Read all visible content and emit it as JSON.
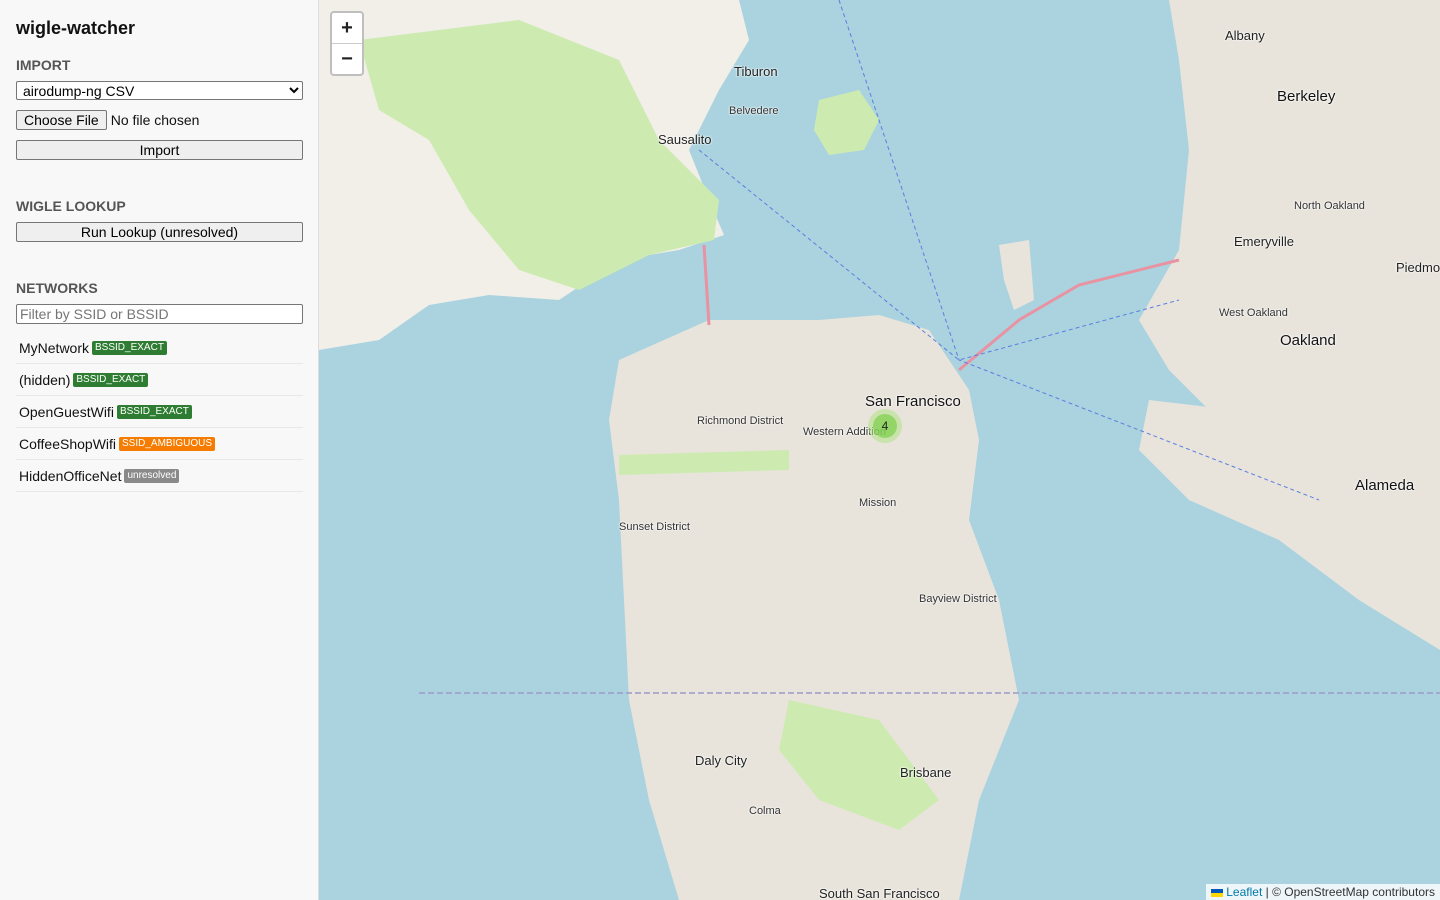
{
  "app": {
    "title": "wigle-watcher"
  },
  "import": {
    "heading": "IMPORT",
    "format_selected": "airodump-ng CSV",
    "choose_file_label": "Choose File",
    "file_status": "No file chosen",
    "import_label": "Import"
  },
  "lookup": {
    "heading": "WIGLE LOOKUP",
    "run_label": "Run Lookup (unresolved)"
  },
  "networks": {
    "heading": "NETWORKS",
    "filter_placeholder": "Filter by SSID or BSSID",
    "items": [
      {
        "ssid": "MyNetwork",
        "status": "BSSID_EXACT",
        "color": "#2e7d32"
      },
      {
        "ssid": "(hidden)",
        "status": "BSSID_EXACT",
        "color": "#2e7d32"
      },
      {
        "ssid": "OpenGuestWifi",
        "status": "BSSID_EXACT",
        "color": "#2e7d32"
      },
      {
        "ssid": "CoffeeShopWifi",
        "status": "SSID_AMBIGUOUS",
        "color": "#f57c00"
      },
      {
        "ssid": "HiddenOfficeNet",
        "status": "unresolved",
        "color": "#8a8a8a"
      }
    ]
  },
  "map": {
    "zoom_in": "+",
    "zoom_out": "−",
    "cluster_count": "4",
    "attribution_leaflet": "Leaflet",
    "attribution_rest": " | © OpenStreetMap contributors",
    "labels": {
      "sf": "San Francisco",
      "oakland": "Oakland",
      "berkeley": "Berkeley",
      "albany": "Albany",
      "emeryville": "Emeryville",
      "alameda": "Alameda",
      "sausalito": "Sausalito",
      "tiburon": "Tiburon",
      "belvedere": "Belvedere",
      "richmond": "Richmond District",
      "western": "Western Addition",
      "mission": "Mission",
      "sunset": "Sunset District",
      "bayview": "Bayview District",
      "daly": "Daly City",
      "brisbane": "Brisbane",
      "colma": "Colma",
      "ssf": "South San Francisco",
      "north_oakland": "North Oakland",
      "west_oakland": "West Oakland",
      "piedmont": "Piedmo"
    }
  }
}
